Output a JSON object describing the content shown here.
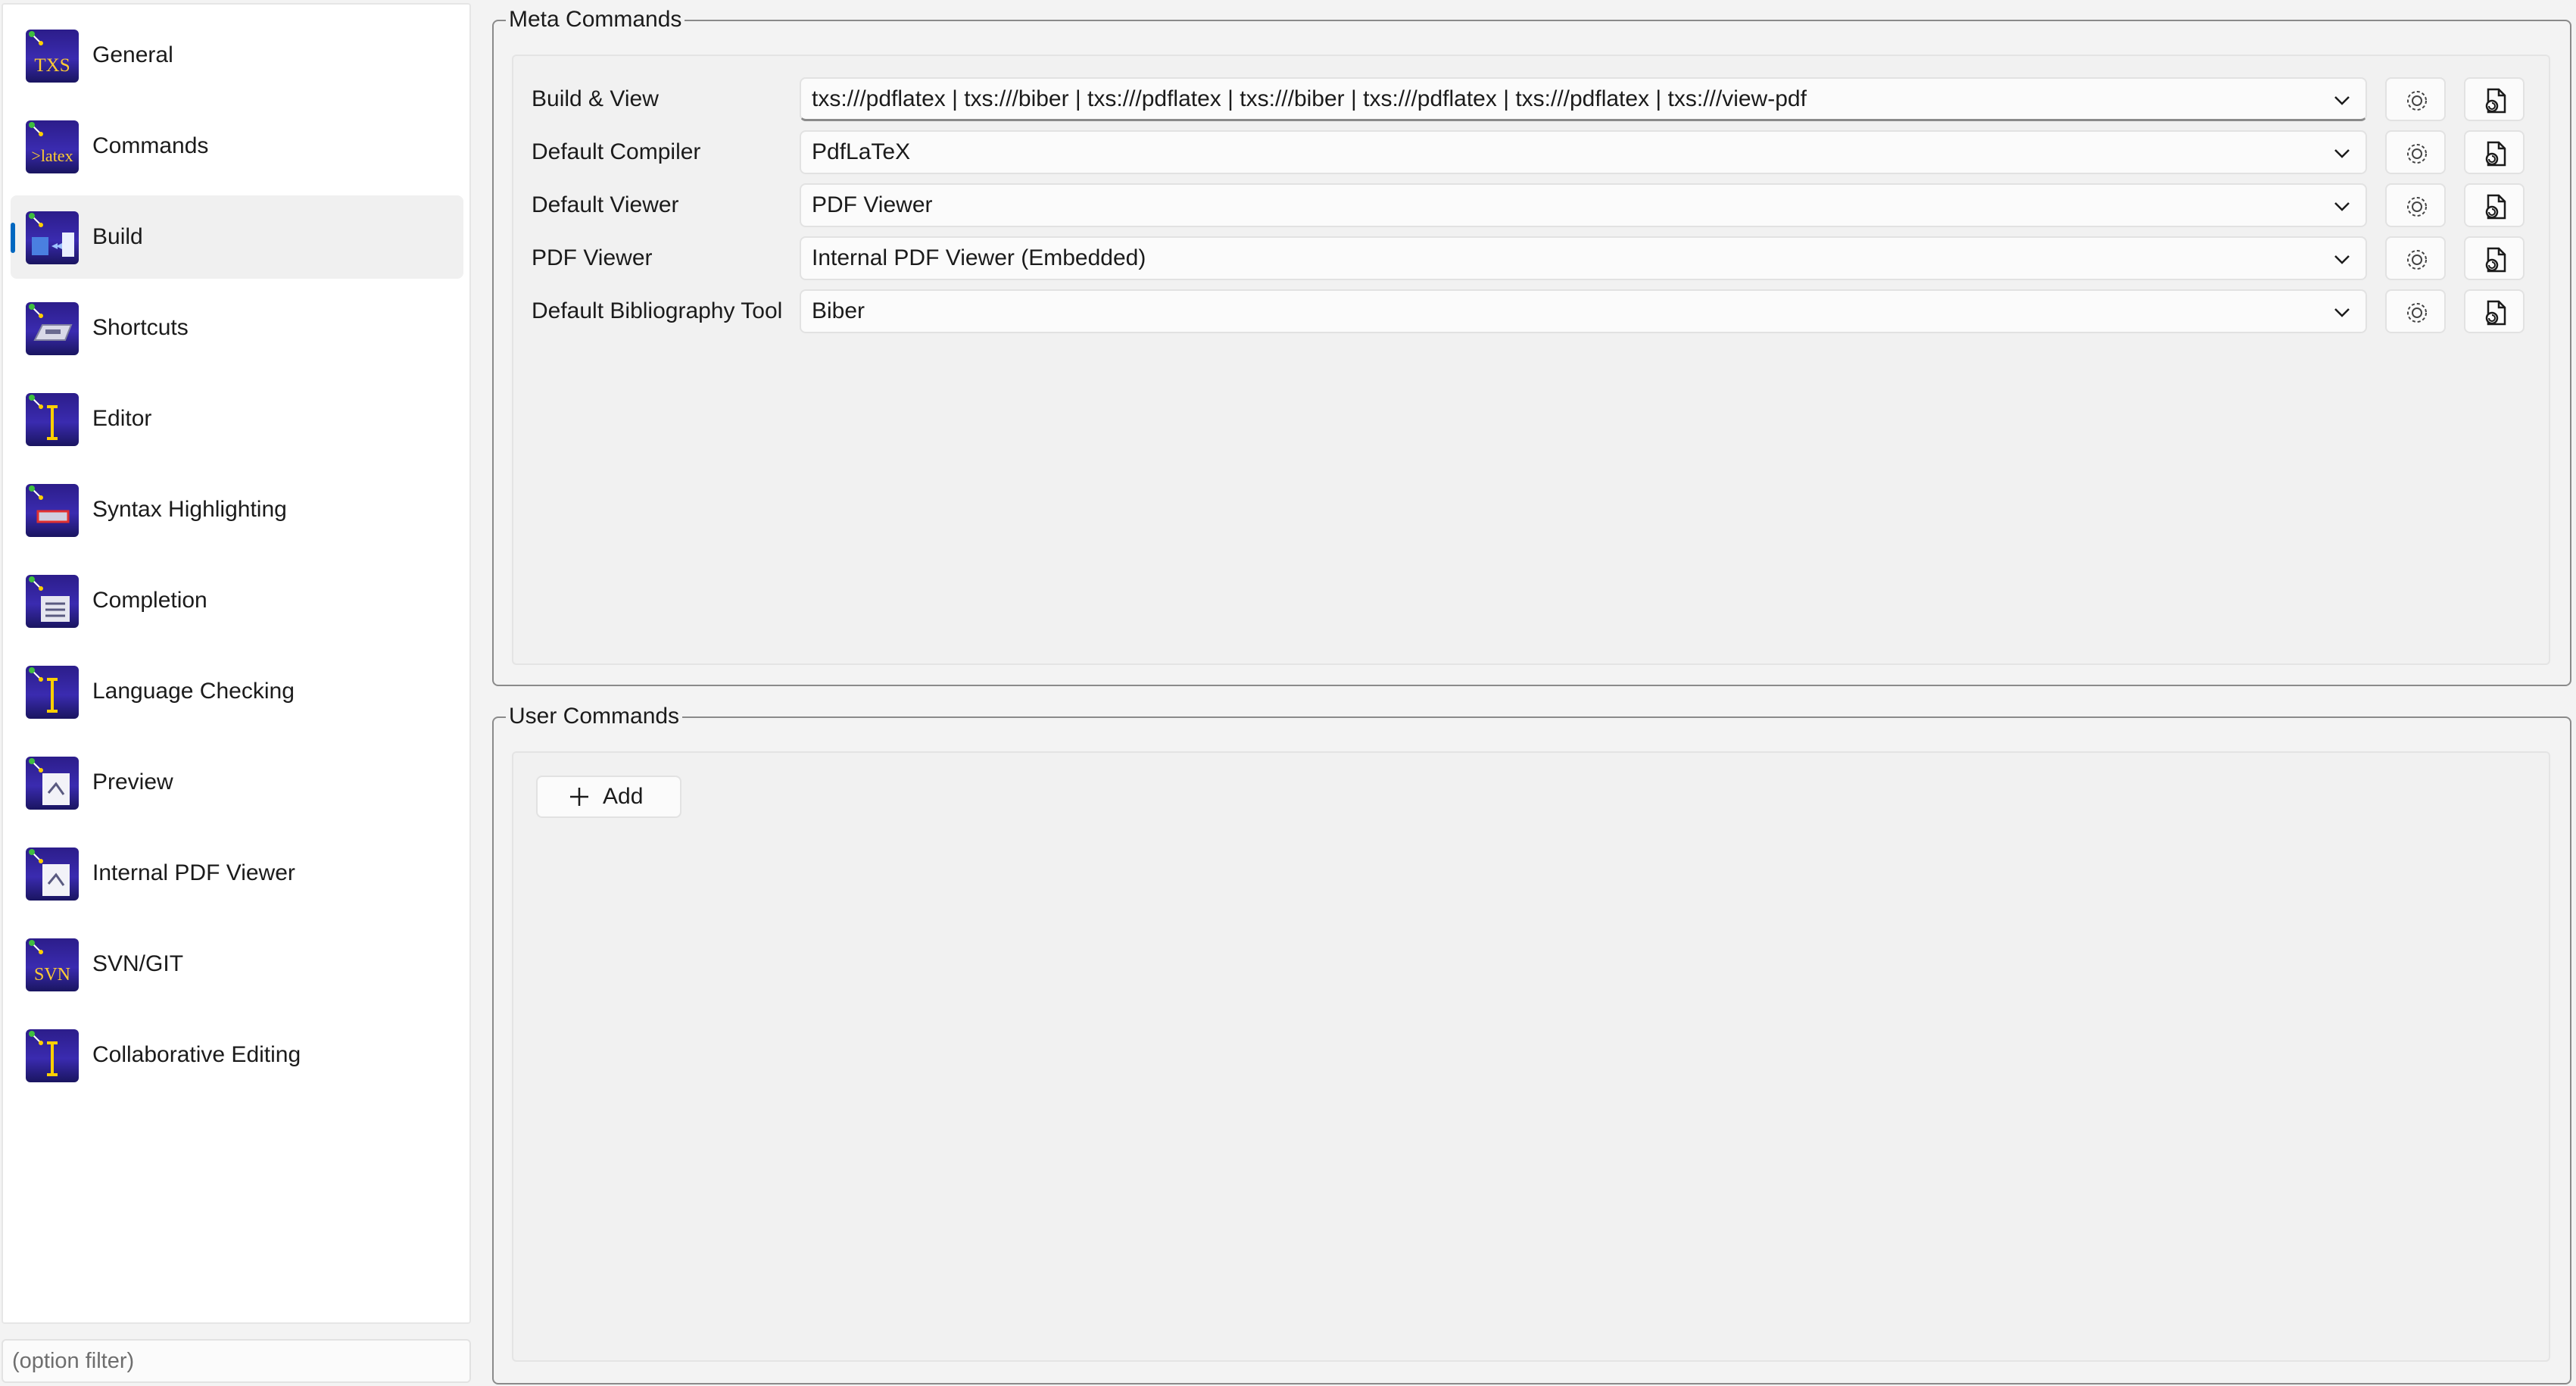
{
  "sidebar": {
    "items": [
      {
        "label": "General",
        "icon": "txs-icon",
        "selected": false
      },
      {
        "label": "Commands",
        "icon": "latex-icon",
        "selected": false
      },
      {
        "label": "Build",
        "icon": "build-icon",
        "selected": true
      },
      {
        "label": "Shortcuts",
        "icon": "keyboard-icon",
        "selected": false
      },
      {
        "label": "Editor",
        "icon": "text-cursor-icon",
        "selected": false
      },
      {
        "label": "Syntax Highlighting",
        "icon": "highlight-icon",
        "selected": false
      },
      {
        "label": "Completion",
        "icon": "completion-icon",
        "selected": false
      },
      {
        "label": "Language Checking",
        "icon": "text-cursor-icon",
        "selected": false
      },
      {
        "label": "Preview",
        "icon": "preview-icon",
        "selected": false
      },
      {
        "label": "Internal PDF Viewer",
        "icon": "preview-icon",
        "selected": false
      },
      {
        "label": "SVN/GIT",
        "icon": "svn-icon",
        "selected": false
      },
      {
        "label": "Collaborative Editing",
        "icon": "text-cursor-icon",
        "selected": false
      }
    ],
    "icon_texts": {
      "txs": "TXS",
      "latex": ">latex",
      "svn": "SVN"
    },
    "filter_placeholder": "(option filter)"
  },
  "meta_commands": {
    "title": "Meta Commands",
    "rows": [
      {
        "label": "Build & View",
        "value": "txs:///pdflatex | txs:///biber | txs:///pdflatex | txs:///biber | txs:///pdflatex | txs:///pdflatex | txs:///view-pdf"
      },
      {
        "label": "Default Compiler",
        "value": "PdfLaTeX"
      },
      {
        "label": "Default Viewer",
        "value": "PDF Viewer"
      },
      {
        "label": "PDF Viewer",
        "value": "Internal PDF Viewer (Embedded)"
      },
      {
        "label": "Default Bibliography Tool",
        "value": "Biber"
      }
    ]
  },
  "user_commands": {
    "title": "User Commands",
    "add_label": "Add"
  },
  "colors": {
    "accent": "#0067c0",
    "icon_bg": "#2c1d8a",
    "window_bg": "#f3f3f3"
  }
}
